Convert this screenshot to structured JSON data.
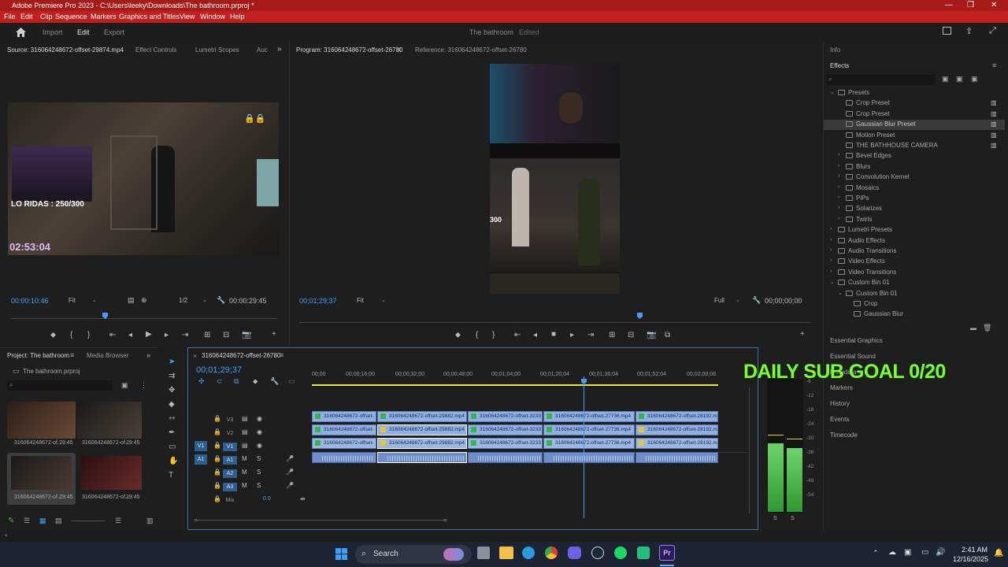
{
  "window": {
    "title": "Adobe Premiere Pro 2023 - C:\\Users\\leeky\\Downloads\\The bathroom.prproj *"
  },
  "menu": [
    "File",
    "Edit",
    "Clip",
    "Sequence",
    "Markers",
    "Graphics and Titles",
    "View",
    "Window",
    "Help"
  ],
  "header": {
    "tabs": [
      "Import",
      "Edit",
      "Export"
    ],
    "active_tab": "Edit",
    "project_name": "The bathroom",
    "status": "Edited"
  },
  "source": {
    "tabs": [
      "Source: 316064248672-offset-29874.mp4",
      "Effect Controls",
      "Lumetri Scopes",
      "Auc"
    ],
    "timecode": "00:00:10:46",
    "fit": "Fit",
    "resolution": "1/2",
    "duration": "00:00:29:45",
    "overlay_text": "LO RIDAS : 250/300",
    "overlay_timer": "02:53:04"
  },
  "program": {
    "tabs": [
      "Program: 316064248672-offset-26780",
      "Reference: 316064248672-offset-26780"
    ],
    "timecode": "00;01;29;37",
    "fit": "Fit",
    "quality": "Full",
    "end_timecode": "00;00;00;00",
    "overlay_text": "300"
  },
  "project": {
    "tabs": [
      "Project: The bathroom",
      "Media Browser"
    ],
    "file": "The bathroom.prproj",
    "items": [
      {
        "name": "316064248672-of...",
        "dur": "29:45"
      },
      {
        "name": "316064248672-of...",
        "dur": "29:45"
      },
      {
        "name": "316064248672-of...",
        "dur": "29:45"
      },
      {
        "name": "316064248672-of...",
        "dur": "29:45"
      }
    ]
  },
  "timeline": {
    "tab": "316064248672-offset-26780",
    "timecode": "00;01;29;37",
    "ruler": [
      "00;00",
      "00;00;16;00",
      "00;00;32;00",
      "00;00;48;00",
      "00;01;04;00",
      "00;01;20;04",
      "00;01;36;04",
      "00;01;52;04",
      "00;02;08;08"
    ],
    "tracks": [
      "V3",
      "V2",
      "V1",
      "A1",
      "A2",
      "A3",
      "Mix"
    ],
    "mix_value": "0.0",
    "clips": [
      "316064248672-offset-",
      "316064248672-offset-29882.mp4",
      "316064248672-offset-3233",
      "316064248672-offset-27736.mp4",
      "316064248672-offset-28192.m"
    ]
  },
  "audio_meter": {
    "ticks": [
      "-6",
      "-12",
      "-18",
      "-24",
      "-30",
      "-36",
      "-42",
      "-48",
      "-54"
    ],
    "labels": [
      "S",
      "S"
    ]
  },
  "effects": {
    "info_tab": "Info",
    "title": "Effects",
    "tree": [
      {
        "label": "Presets",
        "indent": 0,
        "type": "folder",
        "open": true
      },
      {
        "label": "Crop Preset",
        "indent": 1,
        "type": "preset"
      },
      {
        "label": "Crop Preset",
        "indent": 1,
        "type": "preset"
      },
      {
        "label": "Gaussian Blur Preset",
        "indent": 1,
        "type": "preset",
        "selected": true
      },
      {
        "label": "Motion Preset",
        "indent": 1,
        "type": "preset"
      },
      {
        "label": "THE BATHHOUSE CAMERA",
        "indent": 1,
        "type": "preset"
      },
      {
        "label": "Bevel Edges",
        "indent": 1,
        "type": "folder"
      },
      {
        "label": "Blurs",
        "indent": 1,
        "type": "folder"
      },
      {
        "label": "Convolution Kernel",
        "indent": 1,
        "type": "folder"
      },
      {
        "label": "Mosaics",
        "indent": 1,
        "type": "folder"
      },
      {
        "label": "PiPs",
        "indent": 1,
        "type": "folder"
      },
      {
        "label": "Solarizes",
        "indent": 1,
        "type": "folder"
      },
      {
        "label": "Twirls",
        "indent": 1,
        "type": "folder"
      },
      {
        "label": "Lumetri Presets",
        "indent": 0,
        "type": "folder"
      },
      {
        "label": "Audio Effects",
        "indent": 0,
        "type": "folder"
      },
      {
        "label": "Audio Transitions",
        "indent": 0,
        "type": "folder"
      },
      {
        "label": "Video Effects",
        "indent": 0,
        "type": "folder"
      },
      {
        "label": "Video Transitions",
        "indent": 0,
        "type": "folder"
      },
      {
        "label": "Custom Bin 01",
        "indent": 0,
        "type": "folder",
        "open": true
      },
      {
        "label": "Custom Bin 01",
        "indent": 1,
        "type": "folder",
        "open": true
      },
      {
        "label": "Crop",
        "indent": 2,
        "type": "effect"
      },
      {
        "label": "Gaussian Blur",
        "indent": 2,
        "type": "effect"
      }
    ],
    "panels": [
      "Essential Graphics",
      "Essential Sound",
      "Metadata",
      "Markers",
      "History",
      "Events",
      "Timecode"
    ]
  },
  "overlay_goal": "DAILY SUB GOAL 0/20",
  "taskbar": {
    "search": "Search",
    "time": "2:41 AM",
    "date": "12/16/2025"
  },
  "colors": {
    "accent": "#2d8ceb",
    "titlebar": "#a61a17",
    "playhead": "#4a9bff",
    "clip_video": "#9ab7e6",
    "clip_audio": "#6f8ecc",
    "timeline_bar": "#e9e73d"
  }
}
